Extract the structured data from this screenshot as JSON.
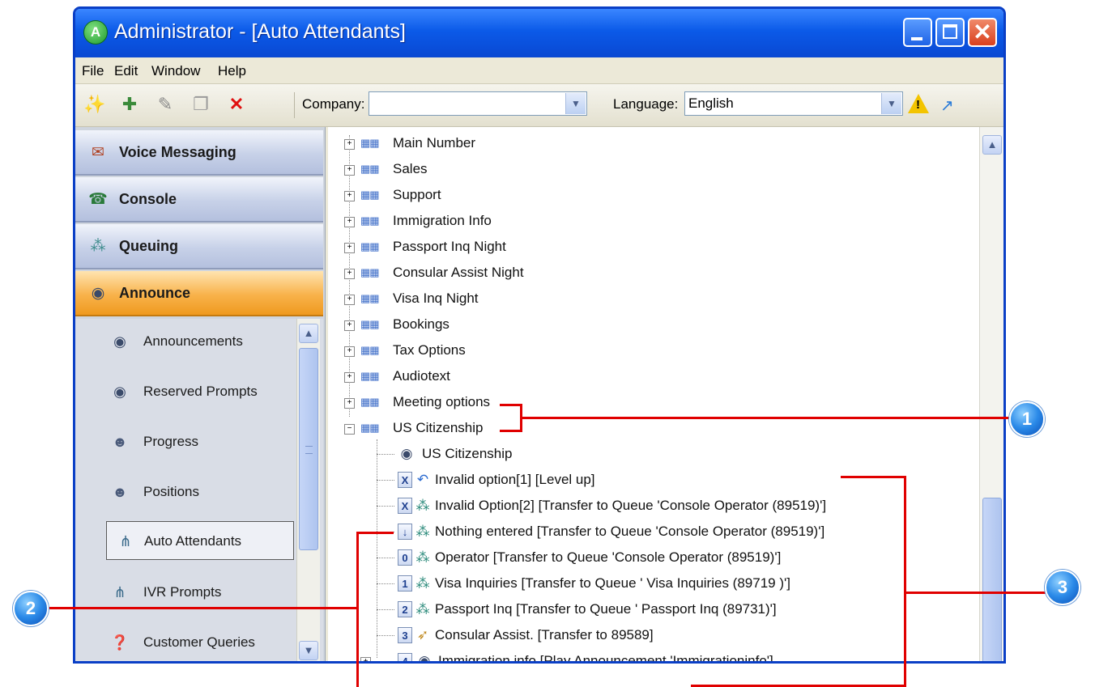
{
  "window": {
    "title": "Administrator - [Auto Attendants]",
    "app_icon_letter": "A"
  },
  "menu": [
    "File",
    "Edit",
    "Window",
    "Help"
  ],
  "toolbar": {
    "company_label": "Company:",
    "company_value": "",
    "language_label": "Language:",
    "language_value": "English"
  },
  "nav": [
    {
      "label": "Voice Messaging",
      "icon": "voice-messaging-icon",
      "active": false
    },
    {
      "label": "Console",
      "icon": "console-icon",
      "active": false
    },
    {
      "label": "Queuing",
      "icon": "queuing-icon",
      "active": false
    },
    {
      "label": "Announce",
      "icon": "announce-icon",
      "active": true
    }
  ],
  "subitems": [
    {
      "label": "Announcements",
      "icon": "announcement-icon"
    },
    {
      "label": "Reserved Prompts",
      "icon": "announcement-icon"
    },
    {
      "label": "Progress",
      "icon": "progress-icon"
    },
    {
      "label": "Positions",
      "icon": "positions-icon"
    },
    {
      "label": "Auto Attendants",
      "icon": "auto-attendant-icon",
      "selected": true
    },
    {
      "label": "IVR Prompts",
      "icon": "ivr-prompt-icon"
    },
    {
      "label": "Customer Queries",
      "icon": "customer-queries-icon"
    }
  ],
  "tree": {
    "nodes": [
      "Main Number",
      "Sales",
      "Support",
      "Immigration Info",
      "Passport Inq Night",
      "Consular Assist Night",
      "Visa Inq Night",
      "Bookings",
      "Tax Options",
      "Audiotext",
      "Meeting options",
      "US Citizenship"
    ],
    "expanded_node": "US Citizenship",
    "children": [
      {
        "key": "",
        "label": "US Citizenship",
        "icon": "announcement-icon"
      },
      {
        "key": "X",
        "label": "Invalid option[1] [Level up]",
        "icon": "level-up-icon"
      },
      {
        "key": "X",
        "label": "Invalid Option[2]  [Transfer to Queue 'Console Operator (89519)']",
        "icon": "queue-icon"
      },
      {
        "key": "↓",
        "label": "Nothing entered  [Transfer to Queue 'Console Operator (89519)']",
        "icon": "queue-icon"
      },
      {
        "key": "0",
        "label": "Operator  [Transfer to Queue 'Console Operator (89519)']",
        "icon": "queue-icon"
      },
      {
        "key": "1",
        "label": "Visa Inquiries  [Transfer to Queue ' Visa Inquiries (89719 )']",
        "icon": "queue-icon"
      },
      {
        "key": "2",
        "label": "Passport Inq  [Transfer to Queue ' Passport Inq  (89731)']",
        "icon": "queue-icon"
      },
      {
        "key": "3",
        "label": "Consular Assist.  [Transfer to 89589]",
        "icon": "transfer-icon"
      },
      {
        "key": "4",
        "label": "Immigration info  [Play Announcement 'Immigrationinfo']",
        "icon": "announcement-icon"
      }
    ]
  },
  "callouts": [
    "1",
    "2",
    "3"
  ],
  "colors": {
    "title_bar": "#0b5ae8",
    "active_nav": "#f8b24a",
    "callout": "#2b8ae8",
    "callout_line": "#e00000"
  }
}
